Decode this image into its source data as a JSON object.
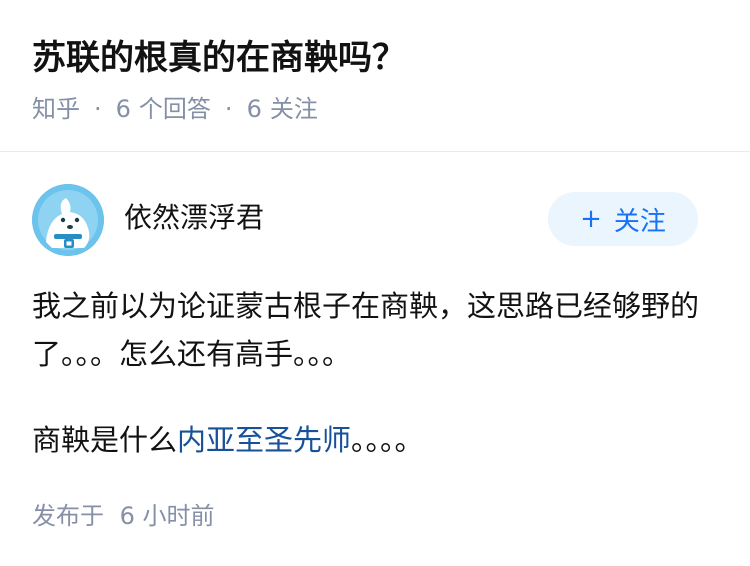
{
  "question": {
    "title": "苏联的根真的在商鞅吗？",
    "site": "知乎",
    "separator": "·",
    "answers_count": "6",
    "answers_label": "个回答",
    "followers_count": "6",
    "followers_label": "关注"
  },
  "answer": {
    "author_name": "依然漂浮君",
    "follow_button": {
      "icon": "+",
      "label": "关注"
    },
    "paragraph1": "我之前以为论证蒙古根子在商鞅，这思路已经够野的了。。。怎么还有高手。。。",
    "paragraph2_prefix": "商鞅是什么",
    "paragraph2_link": "内亚至圣先师",
    "paragraph2_suffix": "。。。。",
    "published_label": "发布于",
    "published_time": "6 小时前"
  },
  "colors": {
    "link": "#175199",
    "accent": "#1772f6",
    "meta": "#8590a6",
    "avatar_bg": "#6cc3ec"
  }
}
